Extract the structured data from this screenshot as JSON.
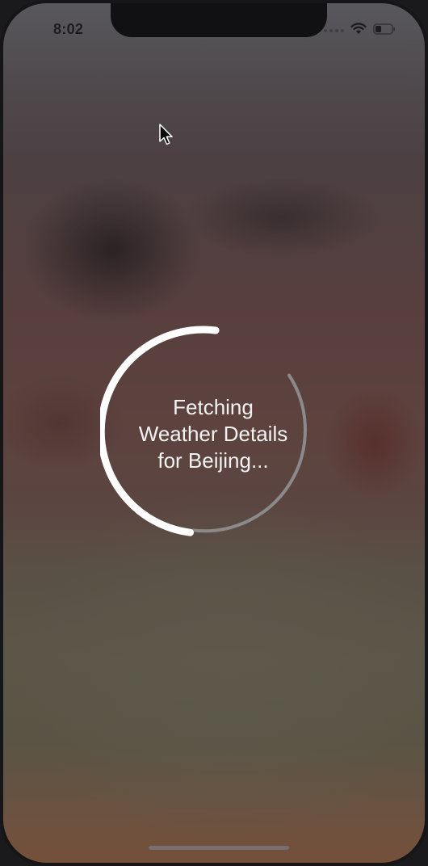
{
  "status_bar": {
    "time": "8:02",
    "icons": [
      "cellular-dots-icon",
      "wifi-icon",
      "battery-icon"
    ]
  },
  "loader": {
    "lines": [
      "Fetching",
      "Weather Details",
      "for Beijing..."
    ]
  },
  "colors": {
    "arc_primary": "#ffffff",
    "arc_secondary": "#8a8a8c",
    "text": "#f2f2f2"
  }
}
